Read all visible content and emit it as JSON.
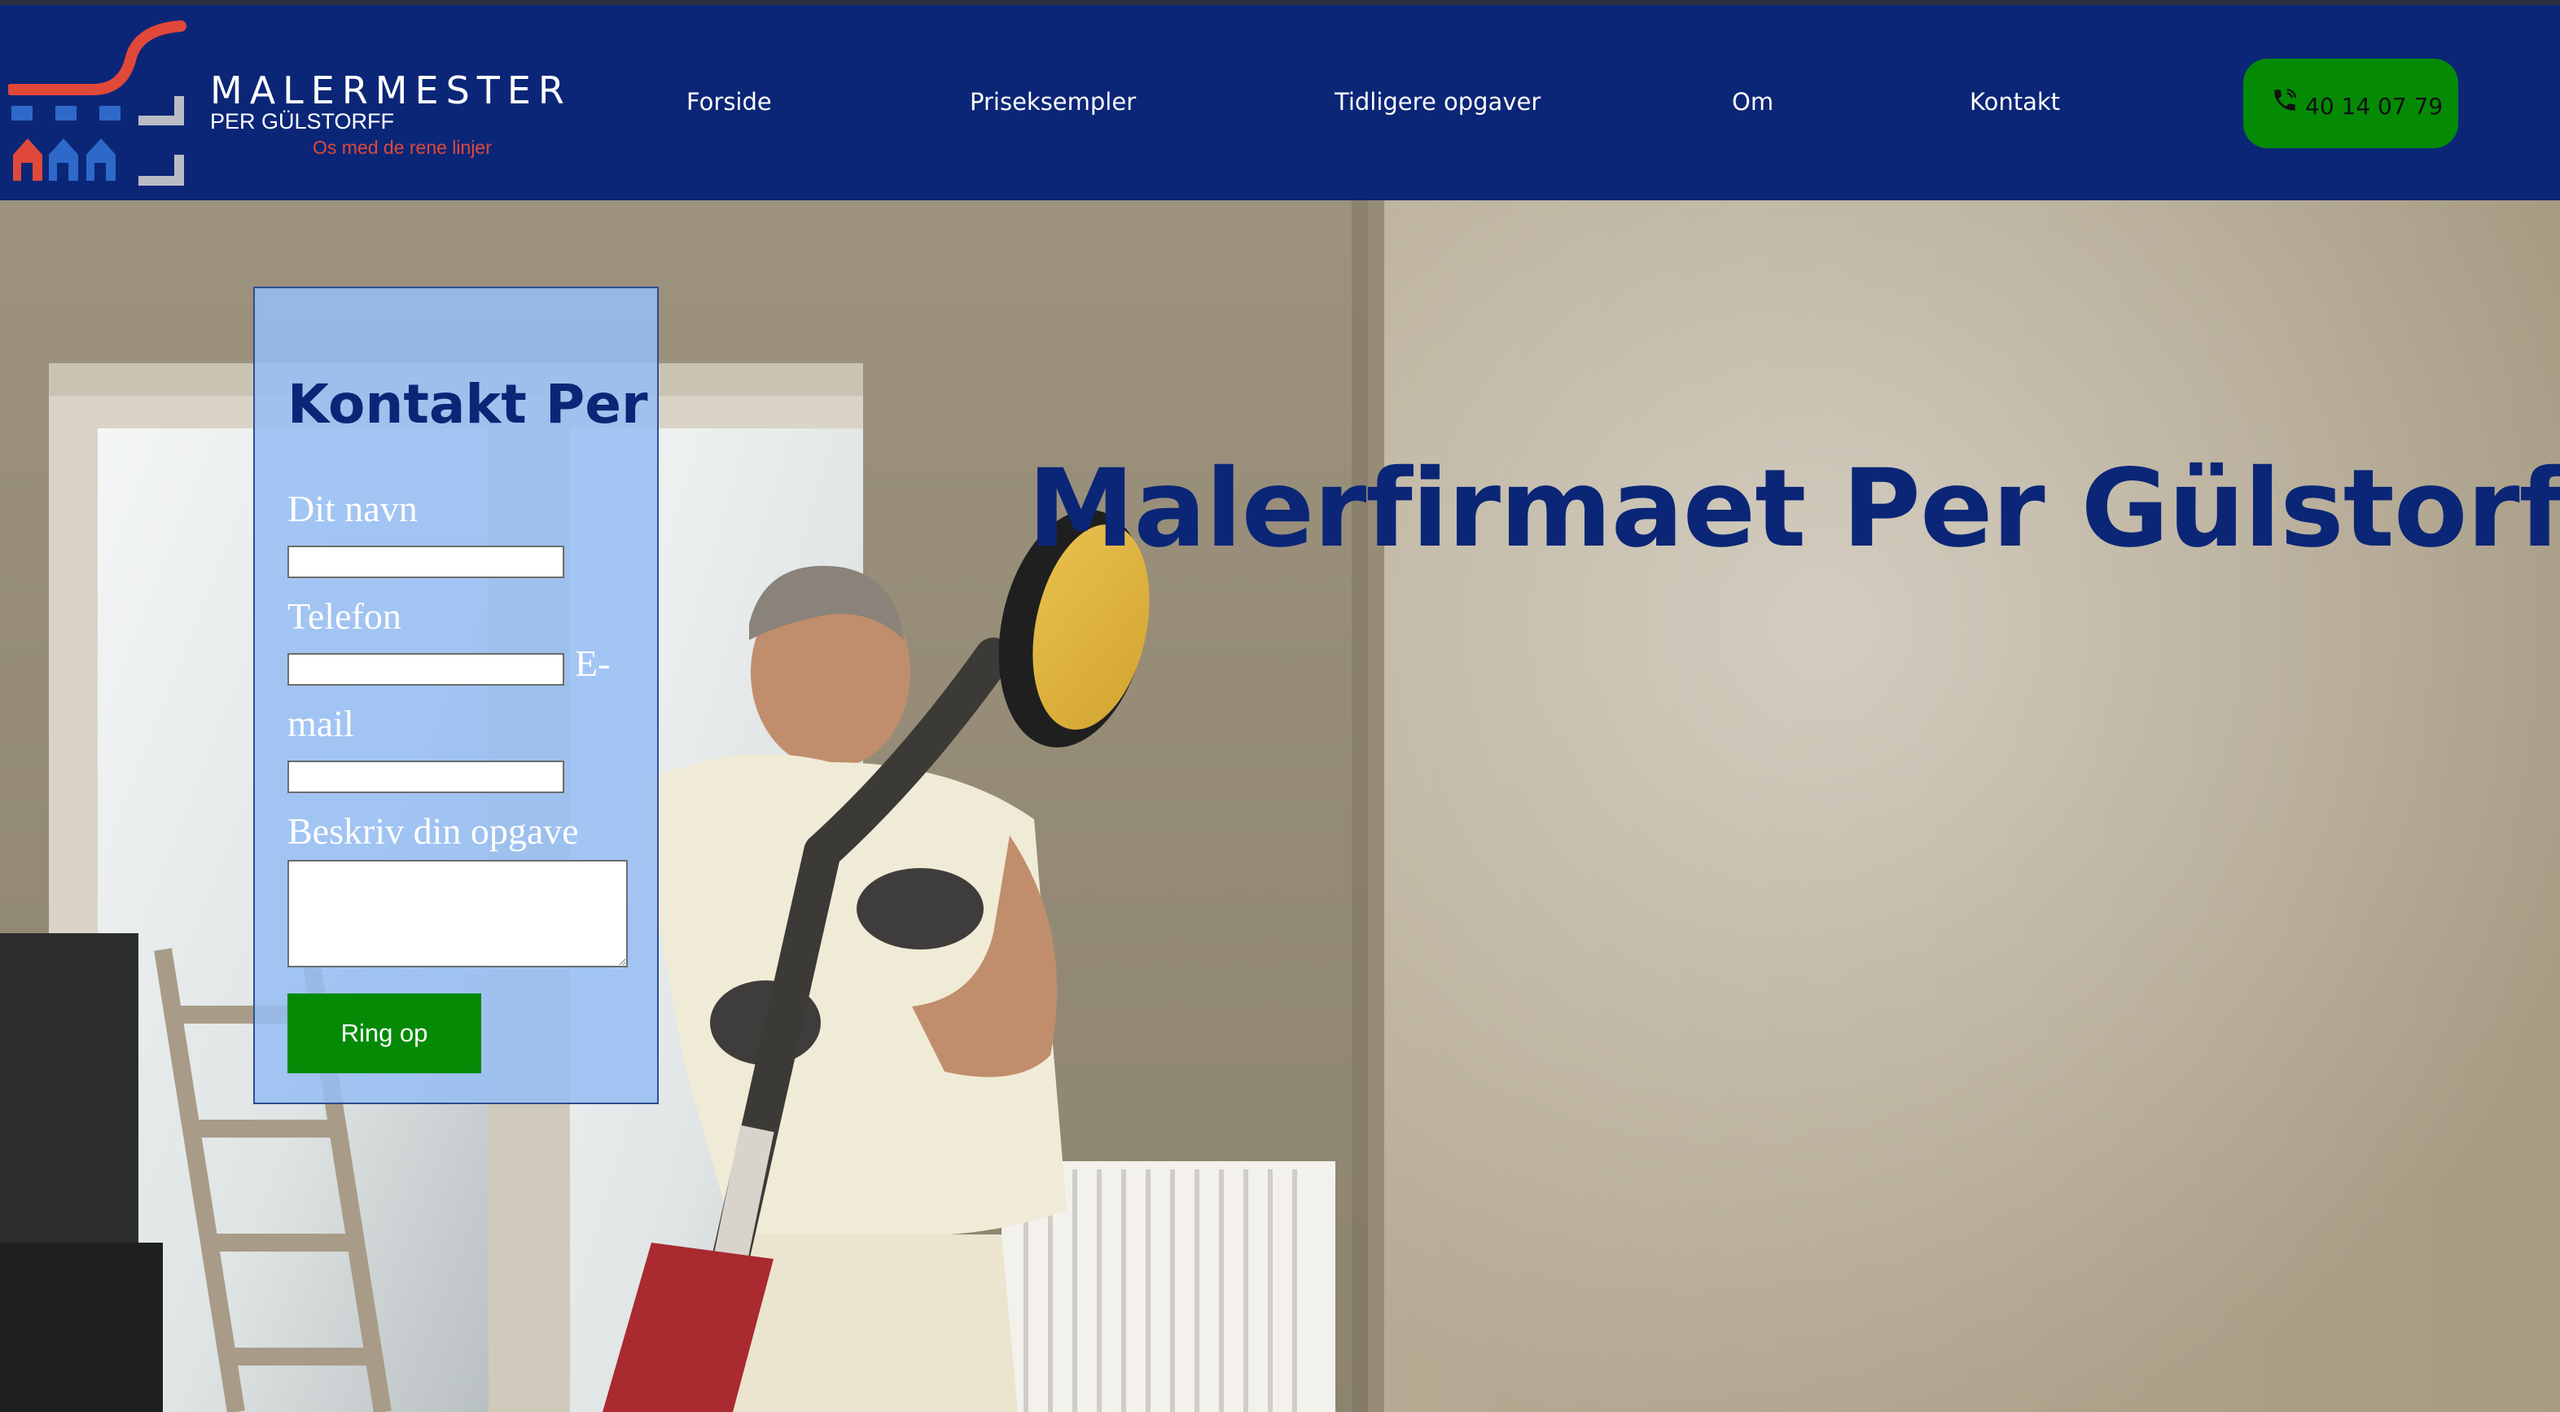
{
  "brand": {
    "name": "MALERMESTER",
    "subname": "PER GÜLSTORFF",
    "tagline": "Os med de rene linjer"
  },
  "nav": {
    "items": [
      {
        "label": "Forside"
      },
      {
        "label": "Priseksempler"
      },
      {
        "label": "Tidligere opgaver"
      },
      {
        "label": "Om"
      },
      {
        "label": "Kontakt"
      }
    ],
    "phone": {
      "icon": "phone-icon",
      "number": "40 14 07 79"
    }
  },
  "hero": {
    "title": "Malerfirmaet Per Gülstorff",
    "image": "painter-sanding-wall-photo"
  },
  "contact_form": {
    "title": "Kontakt Per",
    "name_label": "Dit navn",
    "name_value": "",
    "phone_label": "Telefon",
    "phone_value": "",
    "email_label_1": "E-",
    "email_label_2": "mail",
    "email_value": "",
    "task_label": "Beskriv din opgave",
    "task_value": "",
    "submit_label": "Ring op"
  },
  "colors": {
    "header_bg": "#0b2677",
    "accent_green": "#058a06",
    "tagline_red": "#e0483a",
    "form_panel": "#96bef5"
  }
}
